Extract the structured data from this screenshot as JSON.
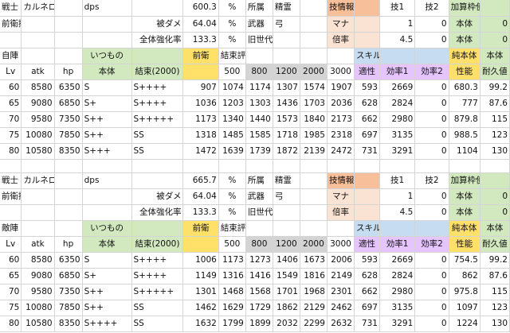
{
  "colors": {
    "green": "#d2e9bf",
    "orange": "#f8c09a",
    "peach": "#fbe3d3",
    "grey": "#d4d4d4",
    "yellow": "#ffe169",
    "lavender": "#e6c5ff",
    "blue": "#c6dcf1"
  },
  "rows": [
    [
      "戦士",
      "カルネロ",
      "",
      "dps",
      "",
      "600.3",
      "%",
      "所属",
      "精霊",
      "",
      "技情報",
      "",
      "技1",
      "技2",
      "加算枠使用率",
      ""
    ],
    [
      "前衛換算",
      "",
      "",
      "",
      "被ダメ",
      "64.04",
      "%",
      "武器",
      "弓",
      "",
      "マナ",
      "",
      "1",
      "0",
      "本体",
      "0"
    ],
    [
      "",
      "",
      "",
      "",
      "全体強化率",
      "133.3",
      "%",
      "旧世代",
      "",
      "",
      "倍率",
      "",
      "4.5",
      "0",
      "本体",
      "0"
    ],
    [
      "自陣",
      "",
      "",
      "いつもの",
      "",
      "前衛",
      "結束評価(純性能総計に対応)",
      "",
      "",
      "",
      "",
      "スキル評価",
      "",
      "",
      "純本体",
      "本体"
    ],
    [
      "Lv",
      "atk",
      "hp",
      "本体",
      "結束(2000)",
      "",
      "500",
      "800",
      "1200",
      "2000",
      "3000",
      "適性",
      "効率1",
      "効率2",
      "性能",
      "耐久値"
    ],
    [
      "60",
      "8580",
      "6350",
      "S",
      "S++++",
      "907",
      "1074",
      "1174",
      "1307",
      "1574",
      "1907",
      "593",
      "2669",
      "0",
      "680.3",
      "99.2"
    ],
    [
      "65",
      "9080",
      "6850",
      "S+",
      "S++++",
      "1036",
      "1203",
      "1303",
      "1436",
      "1703",
      "2036",
      "628",
      "2824",
      "0",
      "777",
      "87.6"
    ],
    [
      "70",
      "9580",
      "7350",
      "S++",
      "S+++++",
      "1173",
      "1340",
      "1440",
      "1573",
      "1840",
      "2173",
      "662",
      "2980",
      "0",
      "879.8",
      "115"
    ],
    [
      "75",
      "10080",
      "7850",
      "S++",
      "SS",
      "1318",
      "1485",
      "1585",
      "1718",
      "1985",
      "2318",
      "697",
      "3135",
      "0",
      "988.5",
      "123"
    ],
    [
      "80",
      "10580",
      "8350",
      "S+++",
      "SS",
      "1472",
      "1639",
      "1739",
      "1872",
      "2139",
      "2472",
      "731",
      "3291",
      "0",
      "1104",
      "130"
    ],
    [
      "",
      "",
      "",
      "",
      "",
      "",
      "",
      "",
      "",
      "",
      "",
      "",
      "",
      "",
      "",
      ""
    ],
    [
      "戦士",
      "カルネロ",
      "",
      "dps",
      "",
      "665.7",
      "%",
      "所属",
      "精霊",
      "",
      "技情報",
      "",
      "技1",
      "技2",
      "加算枠使用率",
      ""
    ],
    [
      "前衛換算",
      "",
      "",
      "",
      "被ダメ",
      "64.04",
      "%",
      "武器",
      "弓",
      "",
      "マナ",
      "",
      "1",
      "0",
      "本体",
      "0"
    ],
    [
      "",
      "",
      "",
      "",
      "全体強化率",
      "133.3",
      "%",
      "旧世代",
      "",
      "",
      "倍率",
      "",
      "4.5",
      "0",
      "本体",
      "0"
    ],
    [
      "敵陣",
      "",
      "",
      "いつもの",
      "",
      "前衛",
      "結束評価(純性能総計に対応)",
      "",
      "",
      "",
      "",
      "スキル評価",
      "",
      "",
      "純本体",
      "本体"
    ],
    [
      "Lv",
      "atk",
      "hp",
      "本体",
      "結束(2000)",
      "",
      "500",
      "800",
      "1200",
      "2000",
      "3000",
      "適性",
      "効率1",
      "効率2",
      "性能",
      "耐久値"
    ],
    [
      "60",
      "8580",
      "6350",
      "S",
      "S++++",
      "1006",
      "1173",
      "1273",
      "1406",
      "1673",
      "2006",
      "593",
      "2669",
      "0",
      "754.5",
      "99.2"
    ],
    [
      "65",
      "9080",
      "6850",
      "S+",
      "S++++",
      "1149",
      "1316",
      "1416",
      "1549",
      "1816",
      "2149",
      "628",
      "2824",
      "0",
      "862",
      "87.6"
    ],
    [
      "70",
      "9580",
      "7350",
      "S++",
      "S+++++",
      "1301",
      "1468",
      "1568",
      "1701",
      "1968",
      "2301",
      "662",
      "2980",
      "0",
      "975.8",
      "115"
    ],
    [
      "75",
      "10080",
      "7850",
      "S++",
      "SS",
      "1462",
      "1629",
      "1729",
      "1862",
      "2129",
      "2462",
      "697",
      "3135",
      "0",
      "1097",
      "123"
    ],
    [
      "80",
      "10580",
      "8350",
      "S++++",
      "SS",
      "1632",
      "1799",
      "1899",
      "2032",
      "2299",
      "2632",
      "731",
      "3291",
      "0",
      "1224",
      "130"
    ]
  ]
}
